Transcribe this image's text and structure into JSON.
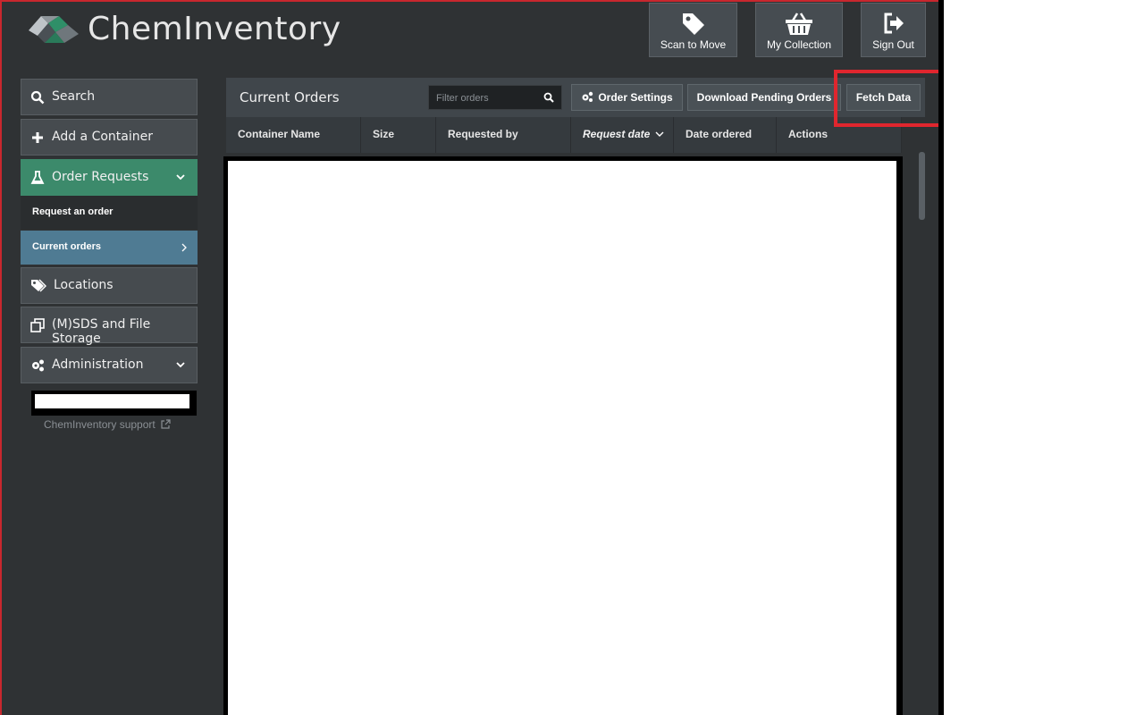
{
  "header": {
    "brand": "ChemInventory",
    "buttons": [
      {
        "label": "Scan to Move",
        "icon": "tag-icon"
      },
      {
        "label": "My Collection",
        "icon": "basket-icon"
      },
      {
        "label": "Sign Out",
        "icon": "sign-out-icon"
      }
    ]
  },
  "sidebar": {
    "items": [
      {
        "label": "Search",
        "icon": "search-icon"
      },
      {
        "label": "Add a Container",
        "icon": "plus-icon"
      },
      {
        "label": "Order Requests",
        "icon": "flask-icon",
        "active": true
      },
      {
        "label": "Locations",
        "icon": "tags-icon"
      },
      {
        "label": "(M)SDS and File Storage",
        "icon": "copy-icon"
      },
      {
        "label": "Administration",
        "icon": "gears-icon"
      }
    ],
    "sub_items": [
      {
        "label": "Request an order"
      },
      {
        "label": "Current orders",
        "selected": true
      }
    ],
    "support_link": "ChemInventory support"
  },
  "panel": {
    "title": "Current Orders",
    "filter_placeholder": "Filter orders",
    "buttons": {
      "order_settings": "Order Settings",
      "download_pending": "Download Pending Orders",
      "fetch_data": "Fetch Data"
    },
    "columns": [
      "Container Name",
      "Size",
      "Requested by",
      "Request date",
      "Date ordered",
      "Actions"
    ],
    "sorted_column": "Request date"
  },
  "colors": {
    "background": "#2f3234",
    "active_green": "#3c8a6b",
    "selected_blue": "#4f7b93",
    "highlight_red": "#e0262e"
  }
}
